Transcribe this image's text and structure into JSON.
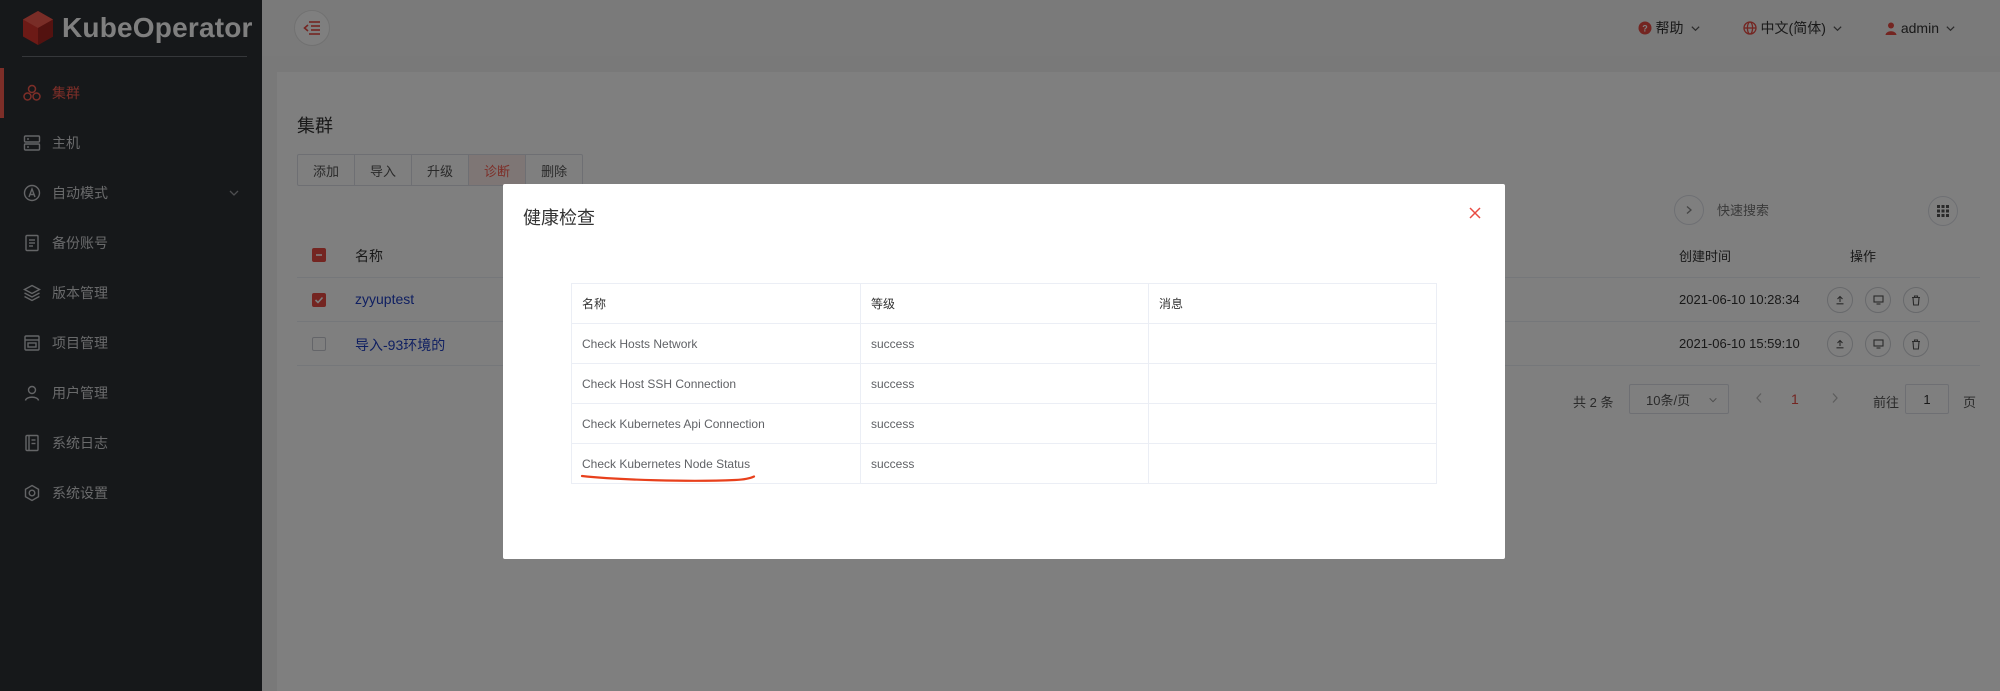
{
  "app": {
    "name": "KubeOperator"
  },
  "sidebar": {
    "items": [
      {
        "label": "集群",
        "icon": "cluster-icon",
        "active": true
      },
      {
        "label": "主机",
        "icon": "host-icon"
      },
      {
        "label": "自动模式",
        "icon": "auto-mode-icon",
        "expandable": true
      },
      {
        "label": "备份账号",
        "icon": "backup-icon"
      },
      {
        "label": "版本管理",
        "icon": "version-icon"
      },
      {
        "label": "项目管理",
        "icon": "project-icon"
      },
      {
        "label": "用户管理",
        "icon": "user-icon"
      },
      {
        "label": "系统日志",
        "icon": "log-icon"
      },
      {
        "label": "系统设置",
        "icon": "settings-icon"
      }
    ]
  },
  "header": {
    "help": "帮助",
    "language": "中文(简体)",
    "user": "admin"
  },
  "page": {
    "title": "集群",
    "buttons": [
      "添加",
      "导入",
      "升级",
      "诊断",
      "删除"
    ],
    "search_placeholder": "快速搜索",
    "table": {
      "columns": {
        "name": "名称",
        "created": "创建时间",
        "ops": "操作"
      },
      "rows": [
        {
          "name": "zyyuptest",
          "created": "2021-06-10 10:28:34",
          "checked": true
        },
        {
          "name": "导入-93环境的",
          "created": "2021-06-10 15:59:10",
          "checked": false
        }
      ]
    },
    "pagination": {
      "total": "共 2 条",
      "page_size": "10条/页",
      "current": "1",
      "goto_label": "前往",
      "goto_value": "1",
      "page_suffix": "页"
    }
  },
  "modal": {
    "title": "健康检查",
    "columns": [
      "名称",
      "等级",
      "消息"
    ],
    "rows": [
      {
        "name": "Check Hosts Network",
        "level": "success",
        "message": ""
      },
      {
        "name": "Check Host SSH Connection",
        "level": "success",
        "message": ""
      },
      {
        "name": "Check Kubernetes Api Connection",
        "level": "success",
        "message": ""
      },
      {
        "name": "Check Kubernetes Node Status",
        "level": "success",
        "message": ""
      }
    ]
  },
  "colors": {
    "accent": "#fa5d50",
    "sidebar": "#2d3035",
    "link": "#1f3ec3",
    "annotation": "#e8401c"
  }
}
